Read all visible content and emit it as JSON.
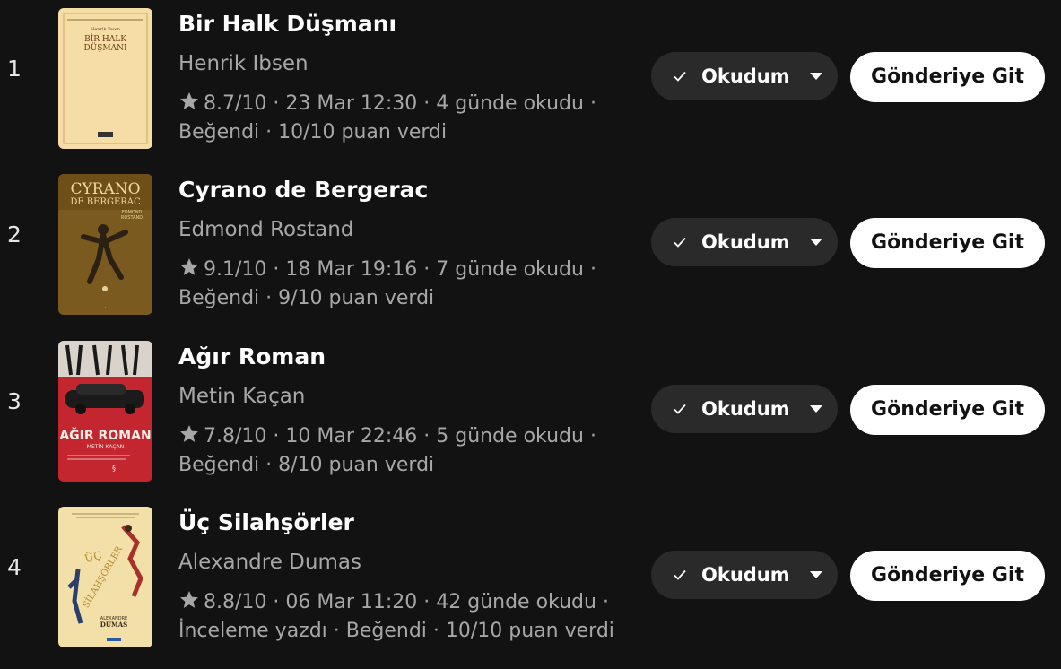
{
  "colors": {
    "background": "#121212",
    "pill_dark": "#2a2a2a",
    "button_light": "#ffffff",
    "text_muted": "#a7a7a7"
  },
  "icons": {
    "rating": "star-icon",
    "status_check": "check-icon",
    "status_menu": "chevron-down-icon"
  },
  "books": [
    {
      "rank": "1",
      "title": "Bir Halk Düşmanı",
      "author": "Henrik Ibsen",
      "meta_line1": "8.7/10 · 23 Mar 12:30 · 4 günde okudu ·",
      "meta_line2": "Beğendi · 10/10 puan verdi",
      "status_label": "Okudum",
      "go_label": "Gönderiye Git",
      "cover_text": [
        "Henrik İbsen",
        "BİR HALK",
        "DÜŞMANI"
      ]
    },
    {
      "rank": "2",
      "title": "Cyrano de Bergerac",
      "author": "Edmond Rostand",
      "meta_line1": "9.1/10 · 18 Mar 19:16 · 7 günde okudu ·",
      "meta_line2": "Beğendi · 9/10 puan verdi",
      "status_label": "Okudum",
      "go_label": "Gönderiye Git",
      "cover_text": [
        "CYRANO",
        "DE BERGERAC",
        "EDMOND",
        "ROSTAND"
      ]
    },
    {
      "rank": "3",
      "title": "Ağır Roman",
      "author": "Metin Kaçan",
      "meta_line1": "7.8/10 · 10 Mar 22:46 · 5 günde okudu ·",
      "meta_line2": "Beğendi · 8/10 puan verdi",
      "status_label": "Okudum",
      "go_label": "Gönderiye Git",
      "cover_text": [
        "AĞIR ROMAN",
        "METİN KAÇAN"
      ]
    },
    {
      "rank": "4",
      "title": "Üç Silahşörler",
      "author": "Alexandre Dumas",
      "meta_line1": "8.8/10 · 06 Mar 11:20 · 42 günde okudu ·",
      "meta_line2": "İnceleme yazdı · Beğendi · 10/10 puan verdi",
      "status_label": "Okudum",
      "go_label": "Gönderiye Git",
      "cover_text": [
        "ÜÇ",
        "SİLAHŞÖRLER",
        "ALEXANDRE",
        "DUMAS"
      ]
    }
  ]
}
